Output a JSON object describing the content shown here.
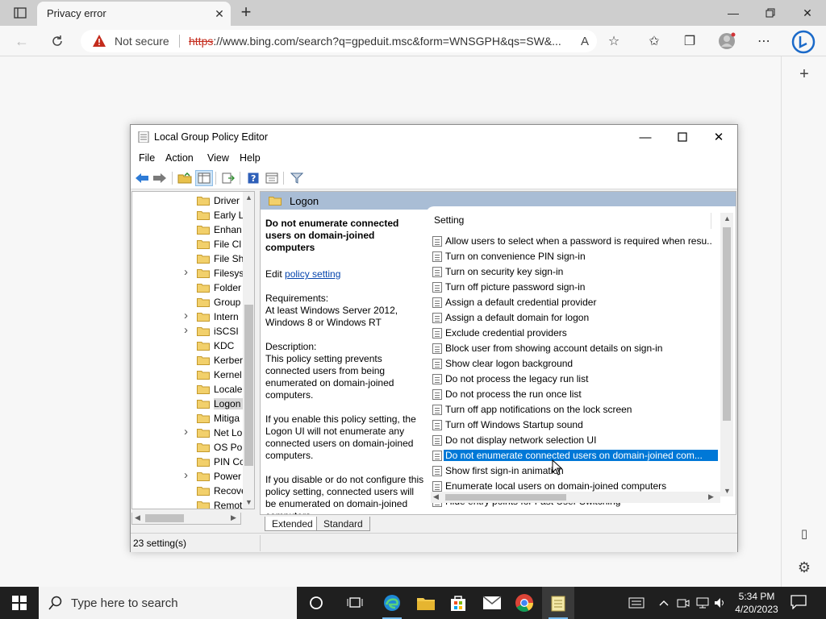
{
  "browser": {
    "tab_title": "Privacy error",
    "not_secure": "Not secure",
    "url_scheme": "https",
    "url_rest": "://www.bing.com/search?q=gpeduit.msc&form=WNSGPH&qs=SW&..."
  },
  "gpe": {
    "title": "Local Group Policy Editor",
    "menu": [
      "File",
      "Action",
      "View",
      "Help"
    ],
    "tree": [
      {
        "label": "Driver",
        "expand": false
      },
      {
        "label": "Early L",
        "expand": false
      },
      {
        "label": "Enhan",
        "expand": false
      },
      {
        "label": "File Cl",
        "expand": false
      },
      {
        "label": "File Sh",
        "expand": false
      },
      {
        "label": "Filesys",
        "expand": true
      },
      {
        "label": "Folder",
        "expand": false
      },
      {
        "label": "Group",
        "expand": false
      },
      {
        "label": "Intern",
        "expand": true
      },
      {
        "label": "iSCSI",
        "expand": true
      },
      {
        "label": "KDC",
        "expand": false
      },
      {
        "label": "Kerber",
        "expand": false
      },
      {
        "label": "Kernel",
        "expand": false
      },
      {
        "label": "Locale",
        "expand": false
      },
      {
        "label": "Logon",
        "expand": false,
        "selected": true
      },
      {
        "label": "Mitiga",
        "expand": false
      },
      {
        "label": "Net Lo",
        "expand": true
      },
      {
        "label": "OS Pol",
        "expand": false
      },
      {
        "label": "PIN Co",
        "expand": false
      },
      {
        "label": "Power",
        "expand": true
      },
      {
        "label": "Recove",
        "expand": false
      },
      {
        "label": "Remot",
        "expand": false
      }
    ],
    "pane_title": "Logon",
    "desc": {
      "title": "Do not enumerate connected users on domain-joined computers",
      "edit_prefix": "Edit ",
      "edit_link": "policy setting",
      "req_label": "Requirements:",
      "req_text": "At least Windows Server 2012, Windows 8 or Windows RT",
      "desc_label": "Description:",
      "desc_text": "This policy setting prevents connected users from being enumerated on domain-joined computers.",
      "enable_text": "If you enable this policy setting, the Logon UI will not enumerate any connected users on domain-joined computers.",
      "disable_text": "If you disable or do not configure this policy setting, connected users will be enumerated on domain-joined computers."
    },
    "list_header": "Setting",
    "settings": [
      "Allow users to select when a password is required when resu...",
      "Turn on convenience PIN sign-in",
      "Turn on security key sign-in",
      "Turn off picture password sign-in",
      "Assign a default credential provider",
      "Assign a default domain for logon",
      "Exclude credential providers",
      "Block user from showing account details on sign-in",
      "Show clear logon background",
      "Do not process the legacy run list",
      "Do not process the run once list",
      "Turn off app notifications on the lock screen",
      "Turn off Windows Startup sound",
      "Do not display network selection UI",
      "Do not enumerate connected users on domain-joined com...",
      "Show first sign-in animation",
      "Enumerate local users on domain-joined computers",
      "Hide entry points for Fast User Switching"
    ],
    "selected_index": 14,
    "tabs": [
      "Extended",
      "Standard"
    ],
    "status": "23 setting(s)"
  },
  "taskbar": {
    "search_placeholder": "Type here to search",
    "time": "5:34 PM",
    "date": "4/20/2023"
  },
  "colors": {
    "accent": "#0078d7",
    "pane_header": "#a9bdd5",
    "taskbar": "#1f1f1f"
  }
}
